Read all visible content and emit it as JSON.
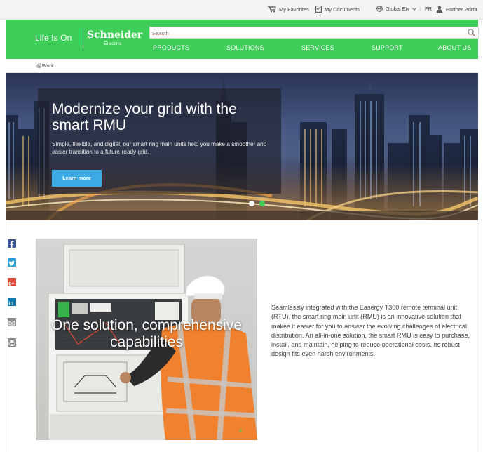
{
  "utility": {
    "favorites": "My Favorites",
    "documents": "My Documents",
    "region": "Global EN",
    "lang": "FR",
    "partner": "Partner Porta"
  },
  "header": {
    "tagline": "Life Is On",
    "brand": "Schneider",
    "brand_sub": "Electric",
    "search_placeholder": "Search",
    "nav": [
      "PRODUCTS",
      "SOLUTIONS",
      "SERVICES",
      "SUPPORT",
      "ABOUT US"
    ],
    "accent_color": "#3dcd58"
  },
  "breadcrumb": "@Work",
  "hero": {
    "title": "Modernize your grid with the smart RMU",
    "text": "Simple, flexible, and digital, our smart ring main units help you make a smoother and easier transition to a future-ready grid.",
    "button": "Learn more",
    "button_color": "#3daae3",
    "carousel_active": 2,
    "carousel_count": 2
  },
  "social": [
    "facebook-icon",
    "twitter-icon",
    "google-plus-icon",
    "linkedin-icon",
    "email-icon",
    "print-icon"
  ],
  "product": {
    "overlay": "One solution, comprehensive capabilities",
    "description": "Seamlessly integrated with the Easergy T300 remote terminal unit (RTU), the smart ring main unit (RMU) is an innovative solution that makes it easier for you to answer the evolving challenges of electrical distribution. An all-in-one solution, the smart RMU is easy to purchase, install, and maintain, helping to reduce operational costs. Its robust design fits even harsh environments."
  }
}
